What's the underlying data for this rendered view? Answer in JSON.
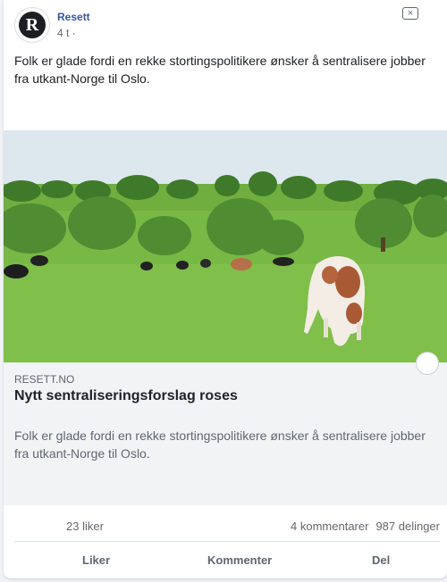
{
  "post": {
    "page_name": "Resett",
    "avatar_letter": "R",
    "time": "4 t ·",
    "close_label": "×",
    "text": "Folk er glade fordi en rekke stortingspolitikere ønsker å sentralisere jobber fra utkant-Norge til Oslo."
  },
  "link": {
    "domain": "RESETT.NO",
    "title": "Nytt sentraliseringsforslag roses",
    "description": "Folk er glade fordi en rekke stortingspolitikere ønsker å sentralisere jobber fra utkant-Norge til Oslo.",
    "image_icon": "cows-grazing-photo"
  },
  "stats": {
    "likes": "23 liker",
    "comments": "4 kommentarer",
    "shares": "987 delinger"
  },
  "actions": {
    "like": "Liker",
    "comment": "Kommenter",
    "share": "Del"
  },
  "colors": {
    "page_name": "#385898",
    "preview_bg": "#f2f3f5",
    "grass": "#6fae3f",
    "sky": "#dfe9ef"
  }
}
